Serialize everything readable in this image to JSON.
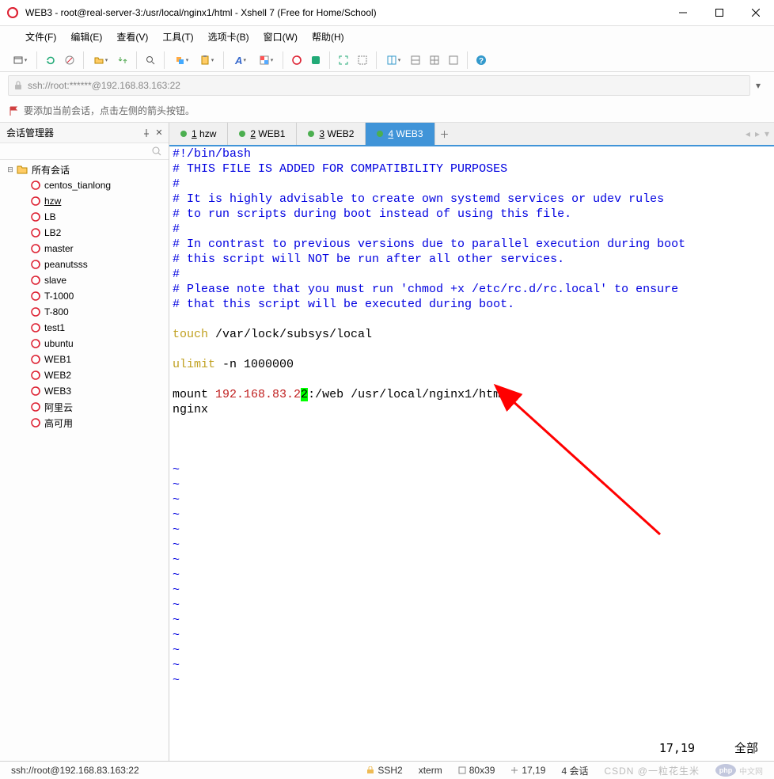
{
  "window": {
    "title": "WEB3 - root@real-server-3:/usr/local/nginx1/html - Xshell 7 (Free for Home/School)"
  },
  "menu": {
    "items": [
      "文件(F)",
      "编辑(E)",
      "查看(V)",
      "工具(T)",
      "选项卡(B)",
      "窗口(W)",
      "帮助(H)"
    ]
  },
  "addressbar": {
    "value": "ssh://root:******@192.168.83.163:22"
  },
  "hint": {
    "text": "要添加当前会话，点击左侧的箭头按钮。"
  },
  "sidepanel": {
    "title": "会话管理器",
    "root": "所有会话",
    "items": [
      "centos_tianlong",
      "hzw",
      "LB",
      "LB2",
      "master",
      "peanutsss",
      "slave",
      "T-1000",
      "T-800",
      "test1",
      "ubuntu",
      "WEB1",
      "WEB2",
      "WEB3",
      "阿里云",
      "高可用"
    ],
    "current": "hzw"
  },
  "tabs": [
    {
      "num": "1",
      "label": "hzw",
      "active": false
    },
    {
      "num": "2",
      "label": "WEB1",
      "active": false
    },
    {
      "num": "3",
      "label": "WEB2",
      "active": false
    },
    {
      "num": "4",
      "label": "WEB3",
      "active": true
    }
  ],
  "terminal": {
    "lines": [
      {
        "cls": "c-blue",
        "text": "#!/bin/bash"
      },
      {
        "cls": "c-blue",
        "text": "# THIS FILE IS ADDED FOR COMPATIBILITY PURPOSES"
      },
      {
        "cls": "c-blue",
        "text": "#"
      },
      {
        "cls": "c-blue",
        "text": "# It is highly advisable to create own systemd services or udev rules"
      },
      {
        "cls": "c-blue",
        "text": "# to run scripts during boot instead of using this file."
      },
      {
        "cls": "c-blue",
        "text": "#"
      },
      {
        "cls": "c-blue",
        "text": "# In contrast to previous versions due to parallel execution during boot"
      },
      {
        "cls": "c-blue",
        "text": "# this script will NOT be run after all other services."
      },
      {
        "cls": "c-blue",
        "text": "#"
      },
      {
        "cls": "c-blue",
        "text": "# Please note that you must run 'chmod +x /etc/rc.d/rc.local' to ensure"
      },
      {
        "cls": "c-blue",
        "text": "# that this script will be executed during boot."
      },
      {
        "cls": "c-black",
        "text": ""
      }
    ],
    "touch_kw": "touch",
    "touch_arg": " /var/lock/subsys/local",
    "ulimit_kw": "ulimit",
    "ulimit_args": " -n 1000000",
    "mount_pre": "mount ",
    "mount_ip_a": "192.168.83.2",
    "mount_ip_cursor": "2",
    "mount_post": ":/web /usr/local/nginx1/html",
    "nginx": "nginx",
    "tilde": "~",
    "tilde_count": 15,
    "cursor_pos": "17,19",
    "scroll_label": "全部"
  },
  "statusbar": {
    "conn": "ssh://root@192.168.83.163:22",
    "proto": "SSH2",
    "term": "xterm",
    "size": "80x39",
    "pos": "17,19",
    "sessions": "4 会话",
    "attribution": "CSDN @一粒花生米",
    "php": "php",
    "cn": "中文网"
  }
}
